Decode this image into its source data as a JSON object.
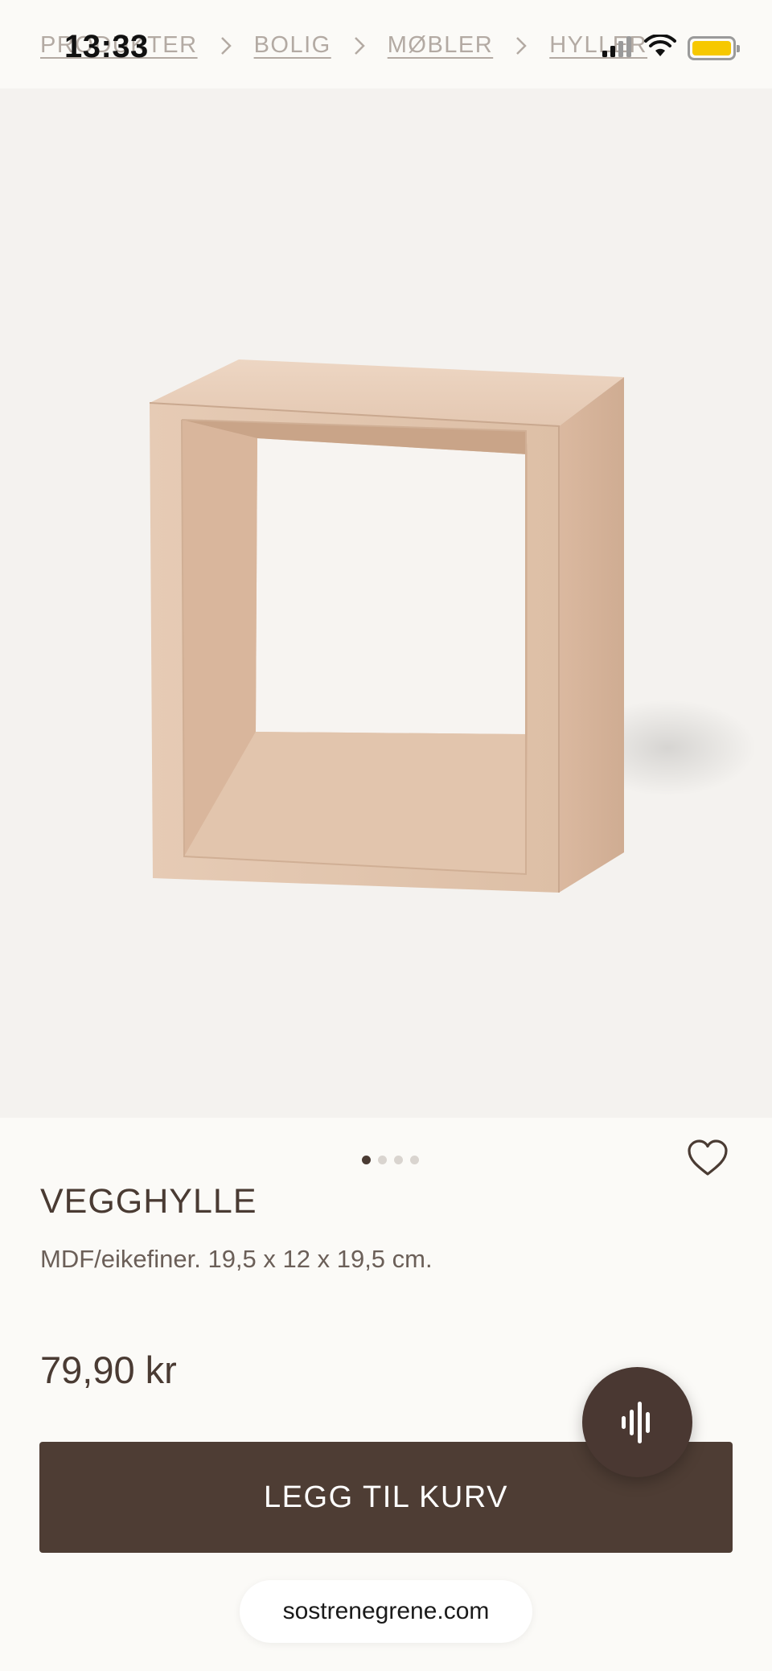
{
  "status_bar": {
    "time": "13:33"
  },
  "breadcrumb": {
    "items": [
      {
        "label": "PRODUKTER"
      },
      {
        "label": "BOLIG"
      },
      {
        "label": "MØBLER"
      },
      {
        "label": "HYLLER"
      }
    ]
  },
  "carousel": {
    "total": 4,
    "active_index": 0
  },
  "product": {
    "title": "VEGGHYLLE",
    "description": "MDF/eikefiner. 19,5 x 12 x 19,5 cm.",
    "price": "79,90 kr"
  },
  "actions": {
    "add_to_cart_label": "LEGG TIL KURV",
    "favorite_icon": "heart-icon",
    "voice_icon": "audio-waveform-icon"
  },
  "browser": {
    "url": "sostrenegrene.com"
  },
  "colors": {
    "primary_button": "#4e3d34",
    "text": "#4a3b33",
    "background": "#fbfaf7",
    "battery": "#f6c800"
  }
}
